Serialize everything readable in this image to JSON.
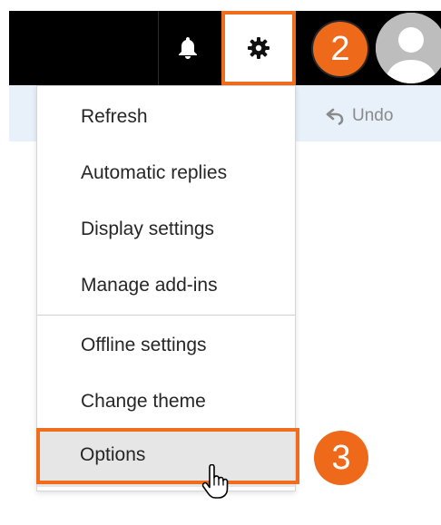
{
  "header": {
    "notifications_icon": "bell-icon",
    "settings_icon": "gear-icon",
    "avatar_icon": "user-avatar"
  },
  "commandbar": {
    "undo_label": "Undo"
  },
  "menu": {
    "items": [
      {
        "label": "Refresh"
      },
      {
        "label": "Automatic replies"
      },
      {
        "label": "Display settings"
      },
      {
        "label": "Manage add-ins"
      },
      {
        "label": "Offline settings"
      },
      {
        "label": "Change theme"
      },
      {
        "label": "Options"
      }
    ]
  },
  "annotations": {
    "step_2": "2",
    "step_3": "3"
  },
  "colors": {
    "accent_orange": "#ef6e1d",
    "topbar": "#000000",
    "commandbar": "#e8f0fa",
    "hover": "#e6e6e6"
  }
}
